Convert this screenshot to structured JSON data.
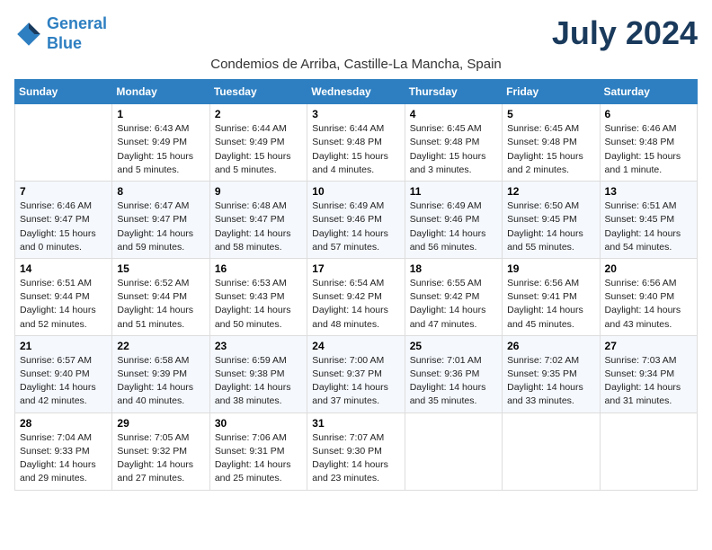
{
  "header": {
    "logo_line1": "General",
    "logo_line2": "Blue",
    "month": "July 2024",
    "location": "Condemios de Arriba, Castille-La Mancha, Spain"
  },
  "columns": [
    "Sunday",
    "Monday",
    "Tuesday",
    "Wednesday",
    "Thursday",
    "Friday",
    "Saturday"
  ],
  "weeks": [
    [
      {
        "day": "",
        "info": ""
      },
      {
        "day": "1",
        "info": "Sunrise: 6:43 AM\nSunset: 9:49 PM\nDaylight: 15 hours\nand 5 minutes."
      },
      {
        "day": "2",
        "info": "Sunrise: 6:44 AM\nSunset: 9:49 PM\nDaylight: 15 hours\nand 5 minutes."
      },
      {
        "day": "3",
        "info": "Sunrise: 6:44 AM\nSunset: 9:48 PM\nDaylight: 15 hours\nand 4 minutes."
      },
      {
        "day": "4",
        "info": "Sunrise: 6:45 AM\nSunset: 9:48 PM\nDaylight: 15 hours\nand 3 minutes."
      },
      {
        "day": "5",
        "info": "Sunrise: 6:45 AM\nSunset: 9:48 PM\nDaylight: 15 hours\nand 2 minutes."
      },
      {
        "day": "6",
        "info": "Sunrise: 6:46 AM\nSunset: 9:48 PM\nDaylight: 15 hours\nand 1 minute."
      }
    ],
    [
      {
        "day": "7",
        "info": "Sunrise: 6:46 AM\nSunset: 9:47 PM\nDaylight: 15 hours\nand 0 minutes."
      },
      {
        "day": "8",
        "info": "Sunrise: 6:47 AM\nSunset: 9:47 PM\nDaylight: 14 hours\nand 59 minutes."
      },
      {
        "day": "9",
        "info": "Sunrise: 6:48 AM\nSunset: 9:47 PM\nDaylight: 14 hours\nand 58 minutes."
      },
      {
        "day": "10",
        "info": "Sunrise: 6:49 AM\nSunset: 9:46 PM\nDaylight: 14 hours\nand 57 minutes."
      },
      {
        "day": "11",
        "info": "Sunrise: 6:49 AM\nSunset: 9:46 PM\nDaylight: 14 hours\nand 56 minutes."
      },
      {
        "day": "12",
        "info": "Sunrise: 6:50 AM\nSunset: 9:45 PM\nDaylight: 14 hours\nand 55 minutes."
      },
      {
        "day": "13",
        "info": "Sunrise: 6:51 AM\nSunset: 9:45 PM\nDaylight: 14 hours\nand 54 minutes."
      }
    ],
    [
      {
        "day": "14",
        "info": "Sunrise: 6:51 AM\nSunset: 9:44 PM\nDaylight: 14 hours\nand 52 minutes."
      },
      {
        "day": "15",
        "info": "Sunrise: 6:52 AM\nSunset: 9:44 PM\nDaylight: 14 hours\nand 51 minutes."
      },
      {
        "day": "16",
        "info": "Sunrise: 6:53 AM\nSunset: 9:43 PM\nDaylight: 14 hours\nand 50 minutes."
      },
      {
        "day": "17",
        "info": "Sunrise: 6:54 AM\nSunset: 9:42 PM\nDaylight: 14 hours\nand 48 minutes."
      },
      {
        "day": "18",
        "info": "Sunrise: 6:55 AM\nSunset: 9:42 PM\nDaylight: 14 hours\nand 47 minutes."
      },
      {
        "day": "19",
        "info": "Sunrise: 6:56 AM\nSunset: 9:41 PM\nDaylight: 14 hours\nand 45 minutes."
      },
      {
        "day": "20",
        "info": "Sunrise: 6:56 AM\nSunset: 9:40 PM\nDaylight: 14 hours\nand 43 minutes."
      }
    ],
    [
      {
        "day": "21",
        "info": "Sunrise: 6:57 AM\nSunset: 9:40 PM\nDaylight: 14 hours\nand 42 minutes."
      },
      {
        "day": "22",
        "info": "Sunrise: 6:58 AM\nSunset: 9:39 PM\nDaylight: 14 hours\nand 40 minutes."
      },
      {
        "day": "23",
        "info": "Sunrise: 6:59 AM\nSunset: 9:38 PM\nDaylight: 14 hours\nand 38 minutes."
      },
      {
        "day": "24",
        "info": "Sunrise: 7:00 AM\nSunset: 9:37 PM\nDaylight: 14 hours\nand 37 minutes."
      },
      {
        "day": "25",
        "info": "Sunrise: 7:01 AM\nSunset: 9:36 PM\nDaylight: 14 hours\nand 35 minutes."
      },
      {
        "day": "26",
        "info": "Sunrise: 7:02 AM\nSunset: 9:35 PM\nDaylight: 14 hours\nand 33 minutes."
      },
      {
        "day": "27",
        "info": "Sunrise: 7:03 AM\nSunset: 9:34 PM\nDaylight: 14 hours\nand 31 minutes."
      }
    ],
    [
      {
        "day": "28",
        "info": "Sunrise: 7:04 AM\nSunset: 9:33 PM\nDaylight: 14 hours\nand 29 minutes."
      },
      {
        "day": "29",
        "info": "Sunrise: 7:05 AM\nSunset: 9:32 PM\nDaylight: 14 hours\nand 27 minutes."
      },
      {
        "day": "30",
        "info": "Sunrise: 7:06 AM\nSunset: 9:31 PM\nDaylight: 14 hours\nand 25 minutes."
      },
      {
        "day": "31",
        "info": "Sunrise: 7:07 AM\nSunset: 9:30 PM\nDaylight: 14 hours\nand 23 minutes."
      },
      {
        "day": "",
        "info": ""
      },
      {
        "day": "",
        "info": ""
      },
      {
        "day": "",
        "info": ""
      }
    ]
  ]
}
